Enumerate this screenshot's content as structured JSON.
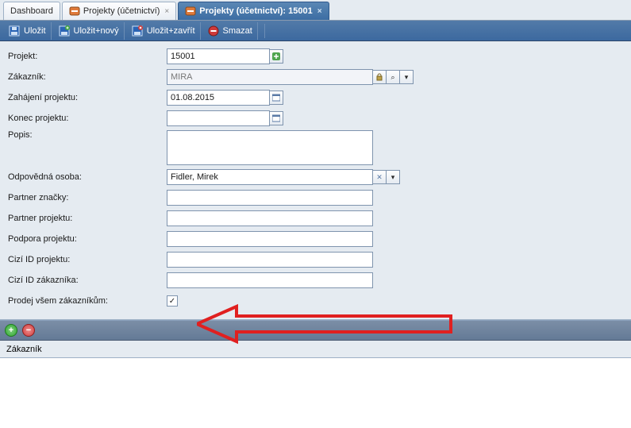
{
  "tabs": [
    {
      "label": "Dashboard",
      "closable": false,
      "active": false
    },
    {
      "label": "Projekty (účetnictví)",
      "closable": true,
      "active": false
    },
    {
      "label": "Projekty (účetnictví): 15001",
      "closable": true,
      "active": true
    }
  ],
  "toolbar": {
    "save": "Uložit",
    "save_new": "Uložit+nový",
    "save_close": "Uložit+zavřít",
    "delete": "Smazat"
  },
  "form": {
    "projekt_label": "Projekt:",
    "projekt_value": "15001",
    "zakaznik_label": "Zákazník:",
    "zakaznik_value": "MIRA",
    "zahajeni_label": "Zahájení projektu:",
    "zahajeni_value": "01.08.2015",
    "konec_label": "Konec projektu:",
    "konec_value": "",
    "popis_label": "Popis:",
    "popis_value": "",
    "odpovedna_label": "Odpovědná osoba:",
    "odpovedna_value": "Fidler, Mirek",
    "partner_znacky_label": "Partner značky:",
    "partner_znacky_value": "",
    "partner_projektu_label": "Partner projektu:",
    "partner_projektu_value": "",
    "podpora_label": "Podpora projektu:",
    "podpora_value": "",
    "cizi_id_projektu_label": "Cizí ID projektu:",
    "cizi_id_projektu_value": "",
    "cizi_id_zakaznika_label": "Cizí ID zákazníka:",
    "cizi_id_zakaznika_value": "",
    "prodej_vsem_label": "Prodej všem zákazníkům:",
    "prodej_vsem_checked": true
  },
  "grid": {
    "header_zakaznik": "Zákazník"
  },
  "glyphs": {
    "check": "✓",
    "close": "×",
    "plus": "+",
    "minus": "−",
    "dropdown": "▾",
    "search": "⌕",
    "clear": "✕"
  }
}
